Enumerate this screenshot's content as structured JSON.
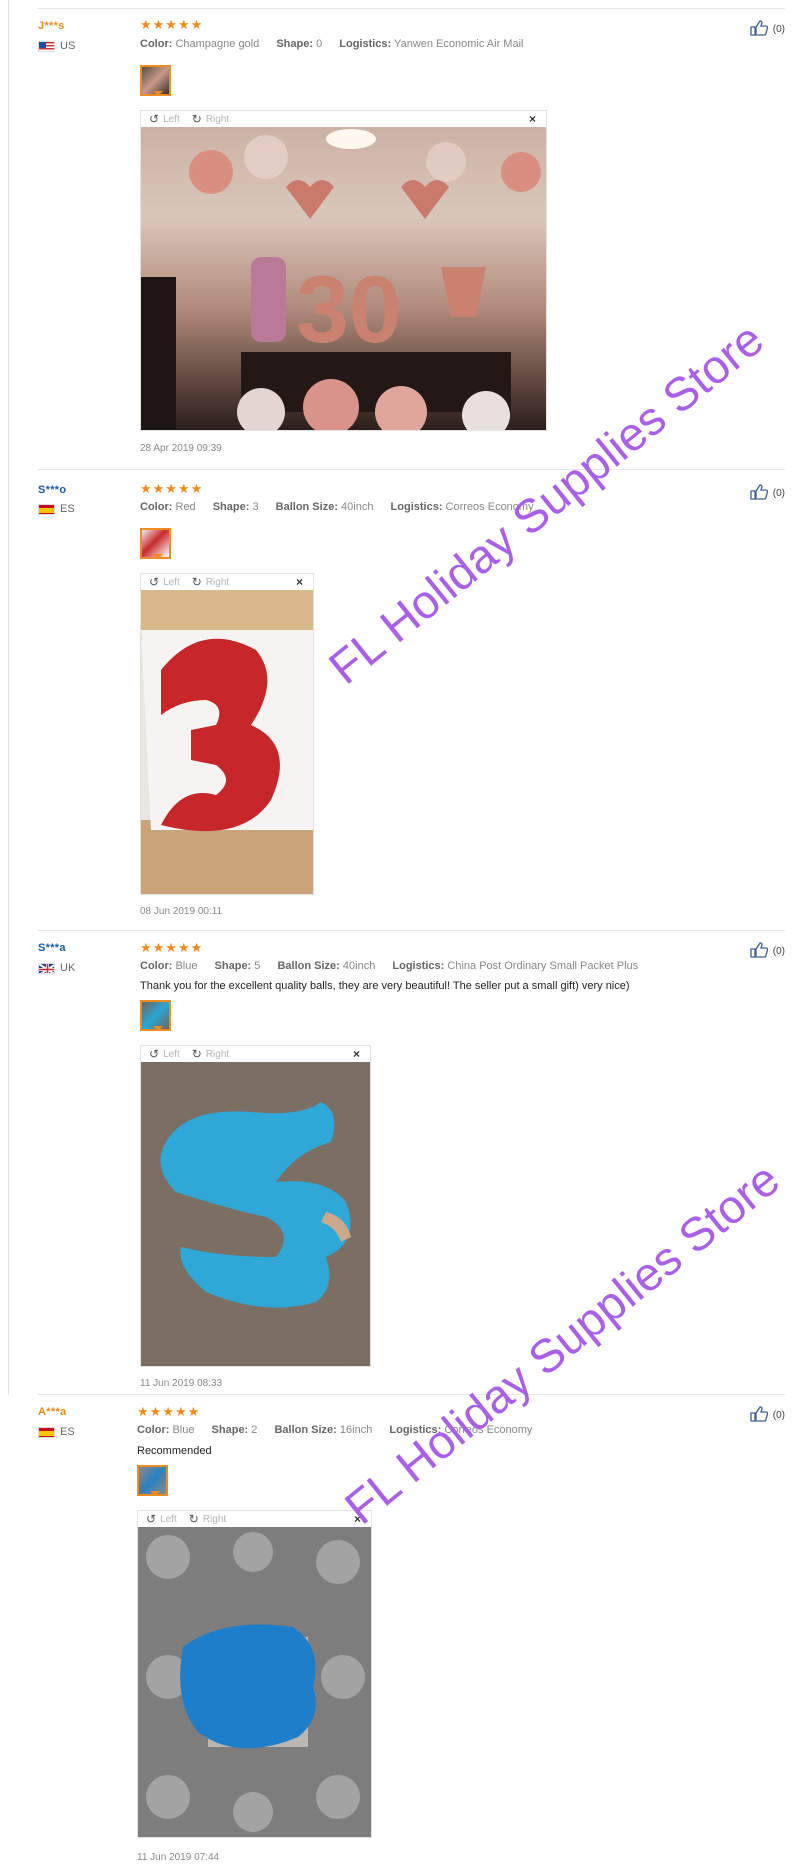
{
  "watermark_text": "FL Holiday Supplies Store",
  "viewer_controls": {
    "left": "Left",
    "right": "Right",
    "close": "×"
  },
  "reviews": [
    {
      "user": "J***s",
      "country": "US",
      "stars": "★★★★★",
      "attrs": [
        {
          "k": "Color:",
          "v": "Champagne gold"
        },
        {
          "k": "Shape:",
          "v": "0"
        },
        {
          "k": "Logistics:",
          "v": "Yanwen Economic Air Mail"
        }
      ],
      "comment": "",
      "date": "28 Apr 2019 09:39",
      "likes": "(0)"
    },
    {
      "user": "S***o",
      "country": "ES",
      "stars": "★★★★★",
      "attrs": [
        {
          "k": "Color:",
          "v": "Red"
        },
        {
          "k": "Shape:",
          "v": "3"
        },
        {
          "k": "Ballon Size:",
          "v": "40inch"
        },
        {
          "k": "Logistics:",
          "v": "Correos Economy"
        }
      ],
      "comment": "",
      "date": "08 Jun 2019 00:11",
      "likes": "(0)"
    },
    {
      "user": "S***a",
      "country": "UK",
      "stars": "★★★★★",
      "attrs": [
        {
          "k": "Color:",
          "v": "Blue"
        },
        {
          "k": "Shape:",
          "v": "5"
        },
        {
          "k": "Ballon Size:",
          "v": "40inch"
        },
        {
          "k": "Logistics:",
          "v": "China Post Ordinary Small Packet Plus"
        }
      ],
      "comment": "Thank you for the excellent quality balls, they are very beautiful! The seller put a small gift) very nice)",
      "date": "11 Jun 2019 08:33",
      "likes": "(0)"
    },
    {
      "user": "A***a",
      "country": "ES",
      "stars": "★★★★★",
      "attrs": [
        {
          "k": "Color:",
          "v": "Blue"
        },
        {
          "k": "Shape:",
          "v": "2"
        },
        {
          "k": "Ballon Size:",
          "v": "16inch"
        },
        {
          "k": "Logistics:",
          "v": "Correos Economy"
        }
      ],
      "comment": "Recommended",
      "date": "11 Jun 2019 07:44",
      "likes": "(0)"
    }
  ],
  "colors": {
    "star": "#f28a1c",
    "user_orange": "#e88a1a",
    "user_blue": "#1d5aa8",
    "watermark": "#a95fe8"
  }
}
